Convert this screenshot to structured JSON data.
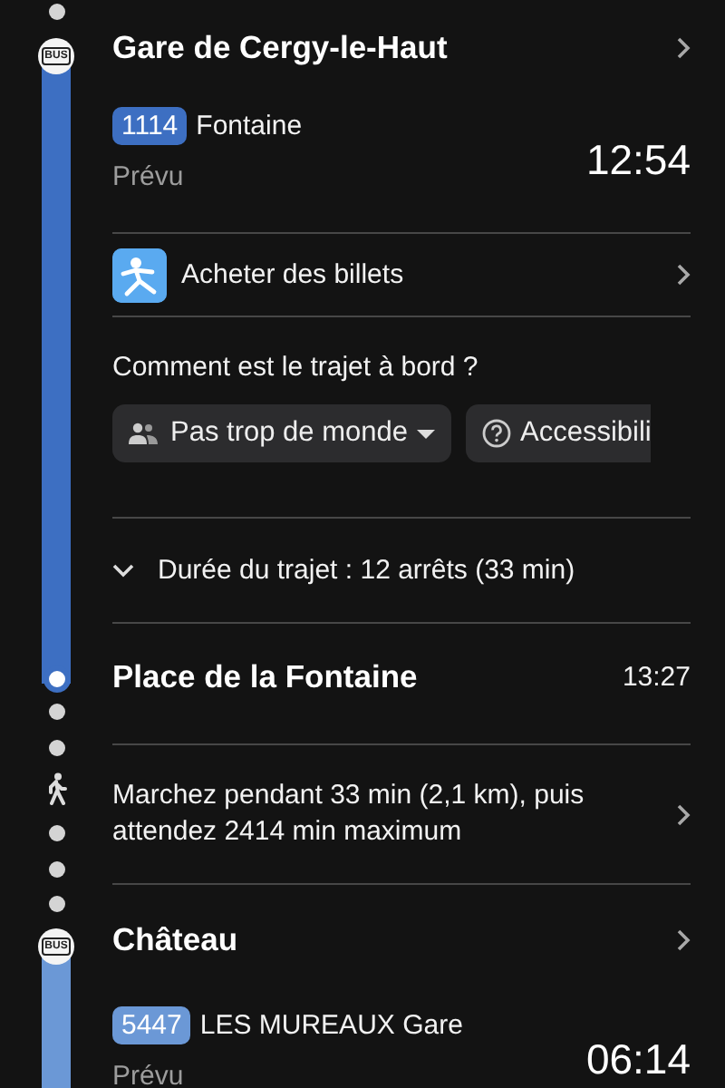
{
  "legs": [
    {
      "kind": "transit",
      "color": "#3d6fc2",
      "mode_label": "BUS",
      "stop": {
        "name": "Gare de Cergy-le-Haut"
      },
      "line": {
        "number": "1114",
        "headsign": "Fontaine",
        "status": "Prévu",
        "time": "12:54"
      },
      "ticket": {
        "label": "Acheter des billets"
      },
      "crowd": {
        "question": "Comment est le trajet à bord ?",
        "chips": [
          {
            "kind": "dropdown",
            "label": "Pas trop de monde"
          },
          {
            "kind": "help",
            "label": "Accessibili"
          }
        ]
      },
      "duration": {
        "label": "Durée du trajet : 12 arrêts (33 min)",
        "expanded": false
      },
      "arrival": {
        "name": "Place de la Fontaine",
        "time": "13:27"
      }
    },
    {
      "kind": "walk",
      "text": "Marchez pendant 33 min (2,1 km), puis attendez 2414 min maximum"
    },
    {
      "kind": "transit",
      "color": "#6b98d6",
      "mode_label": "BUS",
      "stop": {
        "name": "Château"
      },
      "line": {
        "number": "5447",
        "headsign": "LES MUREAUX Gare",
        "status": "Prévu",
        "time": "06:14"
      }
    }
  ]
}
